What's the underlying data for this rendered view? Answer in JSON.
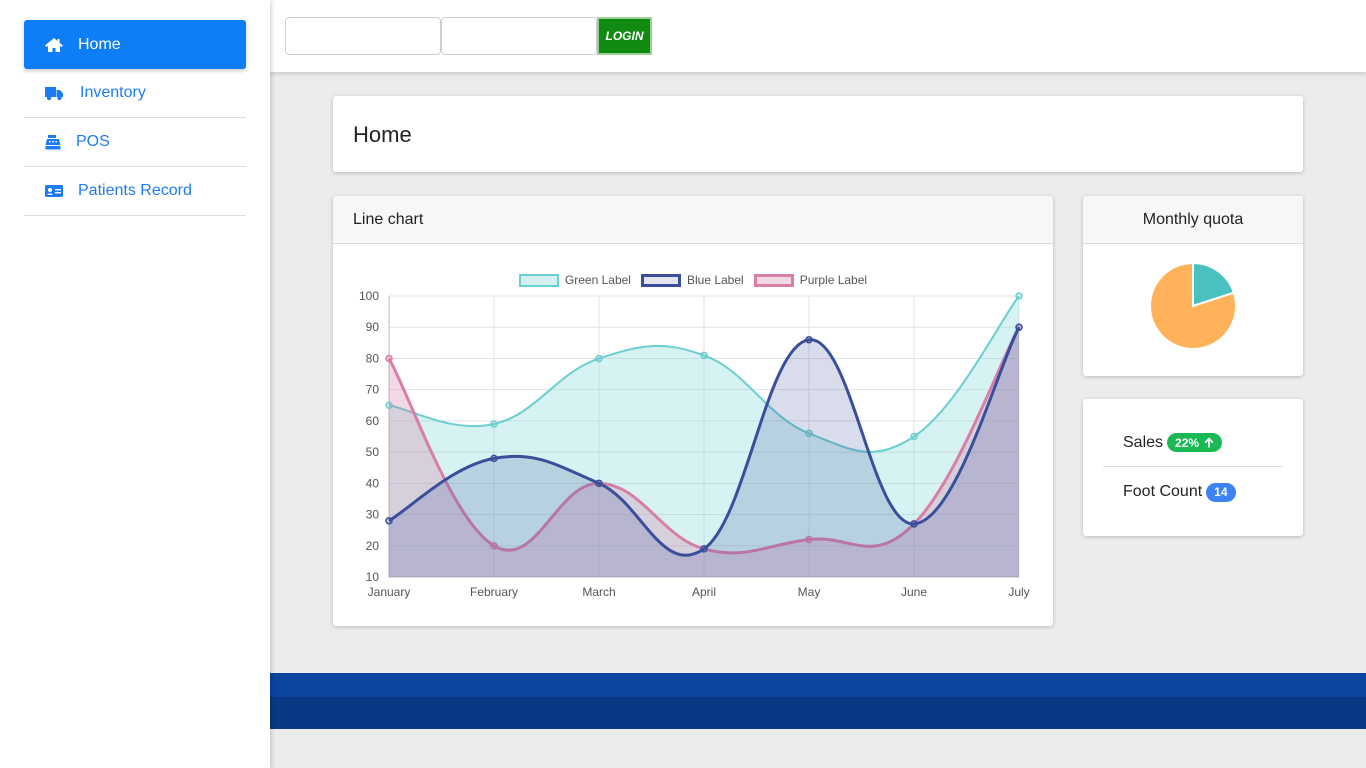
{
  "sidebar": {
    "items": [
      {
        "label": "Home",
        "icon": "home-icon",
        "active": true
      },
      {
        "label": "Inventory",
        "icon": "truck-icon",
        "active": false
      },
      {
        "label": "POS",
        "icon": "cash-register-icon",
        "active": false
      },
      {
        "label": "Patients Record",
        "icon": "id-card-icon",
        "active": false
      }
    ]
  },
  "topbar": {
    "username_value": "",
    "password_value": "",
    "login_label": "LOGIN"
  },
  "page": {
    "title": "Home"
  },
  "line_card": {
    "title": "Line chart"
  },
  "pie_card": {
    "title": "Monthly quota"
  },
  "stats": {
    "sales_label": "Sales",
    "sales_badge": "22%",
    "foot_label": "Foot Count",
    "foot_badge": "14"
  },
  "colors": {
    "accent": "#0d7ef5",
    "login": "#118a11",
    "footer": "#0c45a0",
    "green_series": "#6ccfcf",
    "blue_series": "#3a4f9c",
    "purple_series": "#d87fa8",
    "pie_teal": "#4bc0c0",
    "pie_orange": "#ffb259"
  },
  "chart_data": [
    {
      "type": "line",
      "categories": [
        "January",
        "February",
        "March",
        "April",
        "May",
        "June",
        "July"
      ],
      "ylim": [
        10,
        100
      ],
      "yticks": [
        10,
        20,
        30,
        40,
        50,
        60,
        70,
        80,
        90,
        100
      ],
      "legend": "top",
      "grid": true,
      "series": [
        {
          "name": "Green Label",
          "values": [
            65,
            59,
            80,
            81,
            56,
            55,
            100
          ],
          "color": "#6ccfcf"
        },
        {
          "name": "Blue Label",
          "values": [
            28,
            48,
            40,
            19,
            86,
            27,
            90
          ],
          "color": "#3a4f9c"
        },
        {
          "name": "Purple Label",
          "values": [
            80,
            20,
            40,
            19,
            22,
            27,
            90
          ],
          "color": "#d87fa8"
        }
      ]
    },
    {
      "type": "pie",
      "slices": [
        {
          "value": 20,
          "color": "#4bc0c0"
        },
        {
          "value": 80,
          "color": "#ffb259"
        }
      ]
    }
  ]
}
